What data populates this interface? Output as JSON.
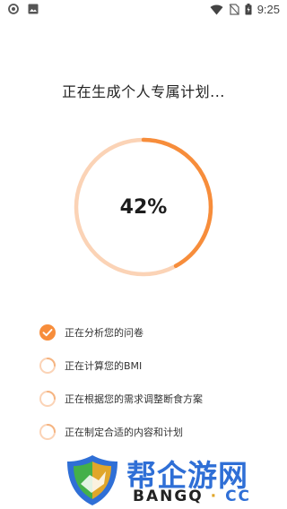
{
  "status_bar": {
    "time": "9:25",
    "icons": [
      "record-icon",
      "image-icon",
      "wifi-icon",
      "no-sim-icon",
      "battery-icon"
    ]
  },
  "title": "正在生成个人专属计划...",
  "progress": {
    "percent_label": "42%",
    "value": 0.42,
    "colors": {
      "track": "#fbd3b6",
      "fill": "#f78d3b"
    }
  },
  "steps": [
    {
      "label": "正在分析您的问卷",
      "state": "done"
    },
    {
      "label": "正在计算您的BMI",
      "state": "loading"
    },
    {
      "label": "正在根据您的需求调整断食方案",
      "state": "loading"
    },
    {
      "label": "正在制定合适的内容和计划",
      "state": "loading"
    }
  ],
  "watermark": {
    "name": "帮企游网",
    "site_part1": "BANGQ",
    "separator": "·",
    "site_part2": "CC",
    "colors": {
      "primary": "#2f6fd6",
      "accent": "#e0a62a",
      "green": "#44b04a"
    }
  }
}
